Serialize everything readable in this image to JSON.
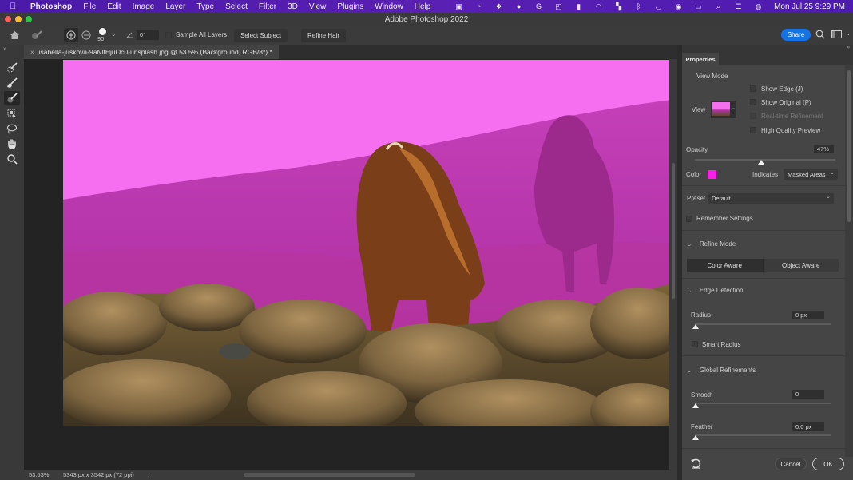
{
  "menubar": {
    "app_name": "Photoshop",
    "items": [
      "File",
      "Edit",
      "Image",
      "Layer",
      "Type",
      "Select",
      "Filter",
      "3D",
      "View",
      "Plugins",
      "Window",
      "Help"
    ],
    "clock": "Mon Jul 25  9:29 PM"
  },
  "window": {
    "title": "Adobe Photoshop 2022"
  },
  "options_bar": {
    "brush_size": "90",
    "angle": "0°",
    "sample_all_layers_label": "Sample All Layers",
    "select_subject_label": "Select Subject",
    "refine_hair_label": "Refine Hair",
    "share_label": "Share"
  },
  "document": {
    "tab_title": "isabella-juskova-9aNltHjuOc0-unsplash.jpg @ 53.5% (Background, RGB/8*) *",
    "zoom": "53.53%",
    "dimensions": "5343 px x 3542 px (72 ppi)"
  },
  "properties": {
    "tab_label": "Properties",
    "view_mode_label": "View Mode",
    "view_label": "View",
    "show_edge_label": "Show Edge (J)",
    "show_original_label": "Show Original (P)",
    "realtime_refinement_label": "Real-time Refinement",
    "high_quality_preview_label": "High Quality Preview",
    "opacity_label": "Opacity",
    "opacity_value": "47%",
    "opacity_fraction": 0.47,
    "color_label": "Color",
    "overlay_color": "#ff1ee6",
    "indicates_label": "Indicates",
    "indicates_value": "Masked Areas",
    "preset_label": "Preset",
    "preset_value": "Default",
    "remember_settings_label": "Remember Settings",
    "refine_mode_label": "Refine Mode",
    "color_aware_label": "Color Aware",
    "object_aware_label": "Object Aware",
    "edge_detection_label": "Edge Detection",
    "radius_label": "Radius",
    "radius_value": "0 px",
    "smart_radius_label": "Smart Radius",
    "global_refinements_label": "Global Refinements",
    "smooth_label": "Smooth",
    "smooth_value": "0",
    "feather_label": "Feather",
    "feather_value": "0.0 px",
    "cancel_label": "Cancel",
    "ok_label": "OK"
  },
  "tools": [
    "quick-selection-brush",
    "refine-edge-brush",
    "brush",
    "object-selection",
    "lasso",
    "hand",
    "zoom"
  ],
  "colors": {
    "accent": "#1473e6",
    "menubar": "#5a1fb3",
    "mask_overlay": "#f56ff0"
  }
}
